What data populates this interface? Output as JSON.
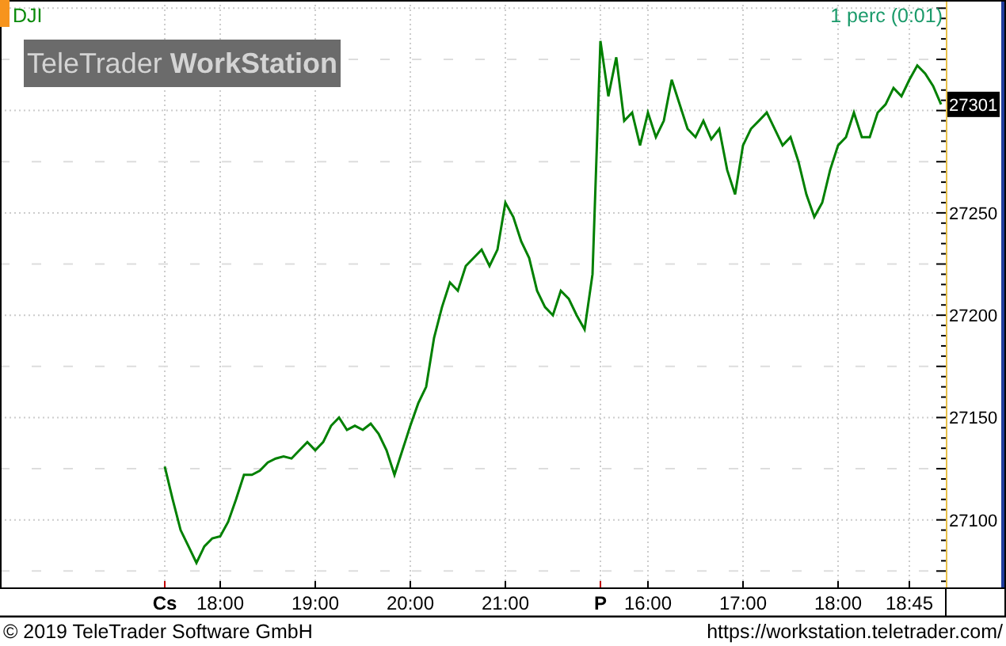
{
  "interval": "1 perc (0:01)",
  "logo": "TeleTrader **WorkStation**",
  "price_marker": "27301",
  "chart": {
    "chart_data": {
      "type": "line",
      "grid": true,
      "ylim": [
        27067,
        27354
      ],
      "categories": [
        null,
        null,
        null,
        null,
        null,
        null,
        null,
        "18:00",
        null,
        null,
        null,
        null,
        null,
        null,
        null,
        null,
        null,
        null,
        null,
        "19:00",
        null,
        null,
        null,
        null,
        null,
        null,
        null,
        null,
        null,
        null,
        null,
        "20:00",
        null,
        null,
        null,
        null,
        null,
        null,
        null,
        null,
        null,
        null,
        null,
        "21:00",
        null,
        null,
        null,
        null,
        null,
        null,
        null,
        null,
        null,
        null,
        null,
        null,
        null,
        null,
        null,
        null,
        null,
        "16:00",
        null,
        null,
        null,
        null,
        null,
        null,
        null,
        null,
        null,
        null,
        null,
        "17:00",
        null,
        null,
        null,
        null,
        null,
        null,
        null,
        null,
        null,
        null,
        null,
        "18:00",
        null,
        null,
        null,
        null,
        null,
        null,
        null,
        null,
        "18:45",
        null,
        null,
        null,
        null
      ],
      "yticks": [
        27100,
        27150,
        27200,
        27250
      ],
      "annotations": [
        "Cs",
        "P"
      ],
      "series": [
        {
          "name": "DJI",
          "color": "#008000",
          "values": [
            27126,
            27110,
            27095,
            27087,
            27079,
            27087,
            27091,
            27092,
            27099,
            27110,
            27122,
            27122,
            27124,
            27128,
            27130,
            27131,
            27130,
            27134,
            27138,
            27134,
            27138,
            27146,
            27150,
            27144,
            27146,
            27144,
            27147,
            27142,
            27134,
            27122,
            27134,
            27146,
            27157,
            27165,
            27189,
            27204,
            27216,
            27212,
            27224,
            27228,
            27232,
            27224,
            27232,
            27255,
            27248,
            27236,
            27228,
            27212,
            27204,
            27200,
            27212,
            27208,
            27200,
            27193,
            27220,
            27334,
            27307,
            27326,
            27295,
            27299,
            27283,
            27299,
            27287,
            27295,
            27315,
            27303,
            27291,
            27287,
            27295,
            27286,
            27291,
            27271,
            27259,
            27283,
            27291,
            27295,
            27299,
            27291,
            27283,
            27287,
            27275,
            27259,
            27248,
            27255,
            27271,
            27283,
            27287,
            27299,
            27287,
            27287,
            27299,
            27303,
            27311,
            27307,
            27315,
            27322,
            27318,
            27312,
            27303
          ]
        }
      ]
    }
  },
  "footer": {
    "copyright": "© 2019 TeleTrader Software GmbH",
    "url": "https://workstation.teletrader.com/"
  }
}
